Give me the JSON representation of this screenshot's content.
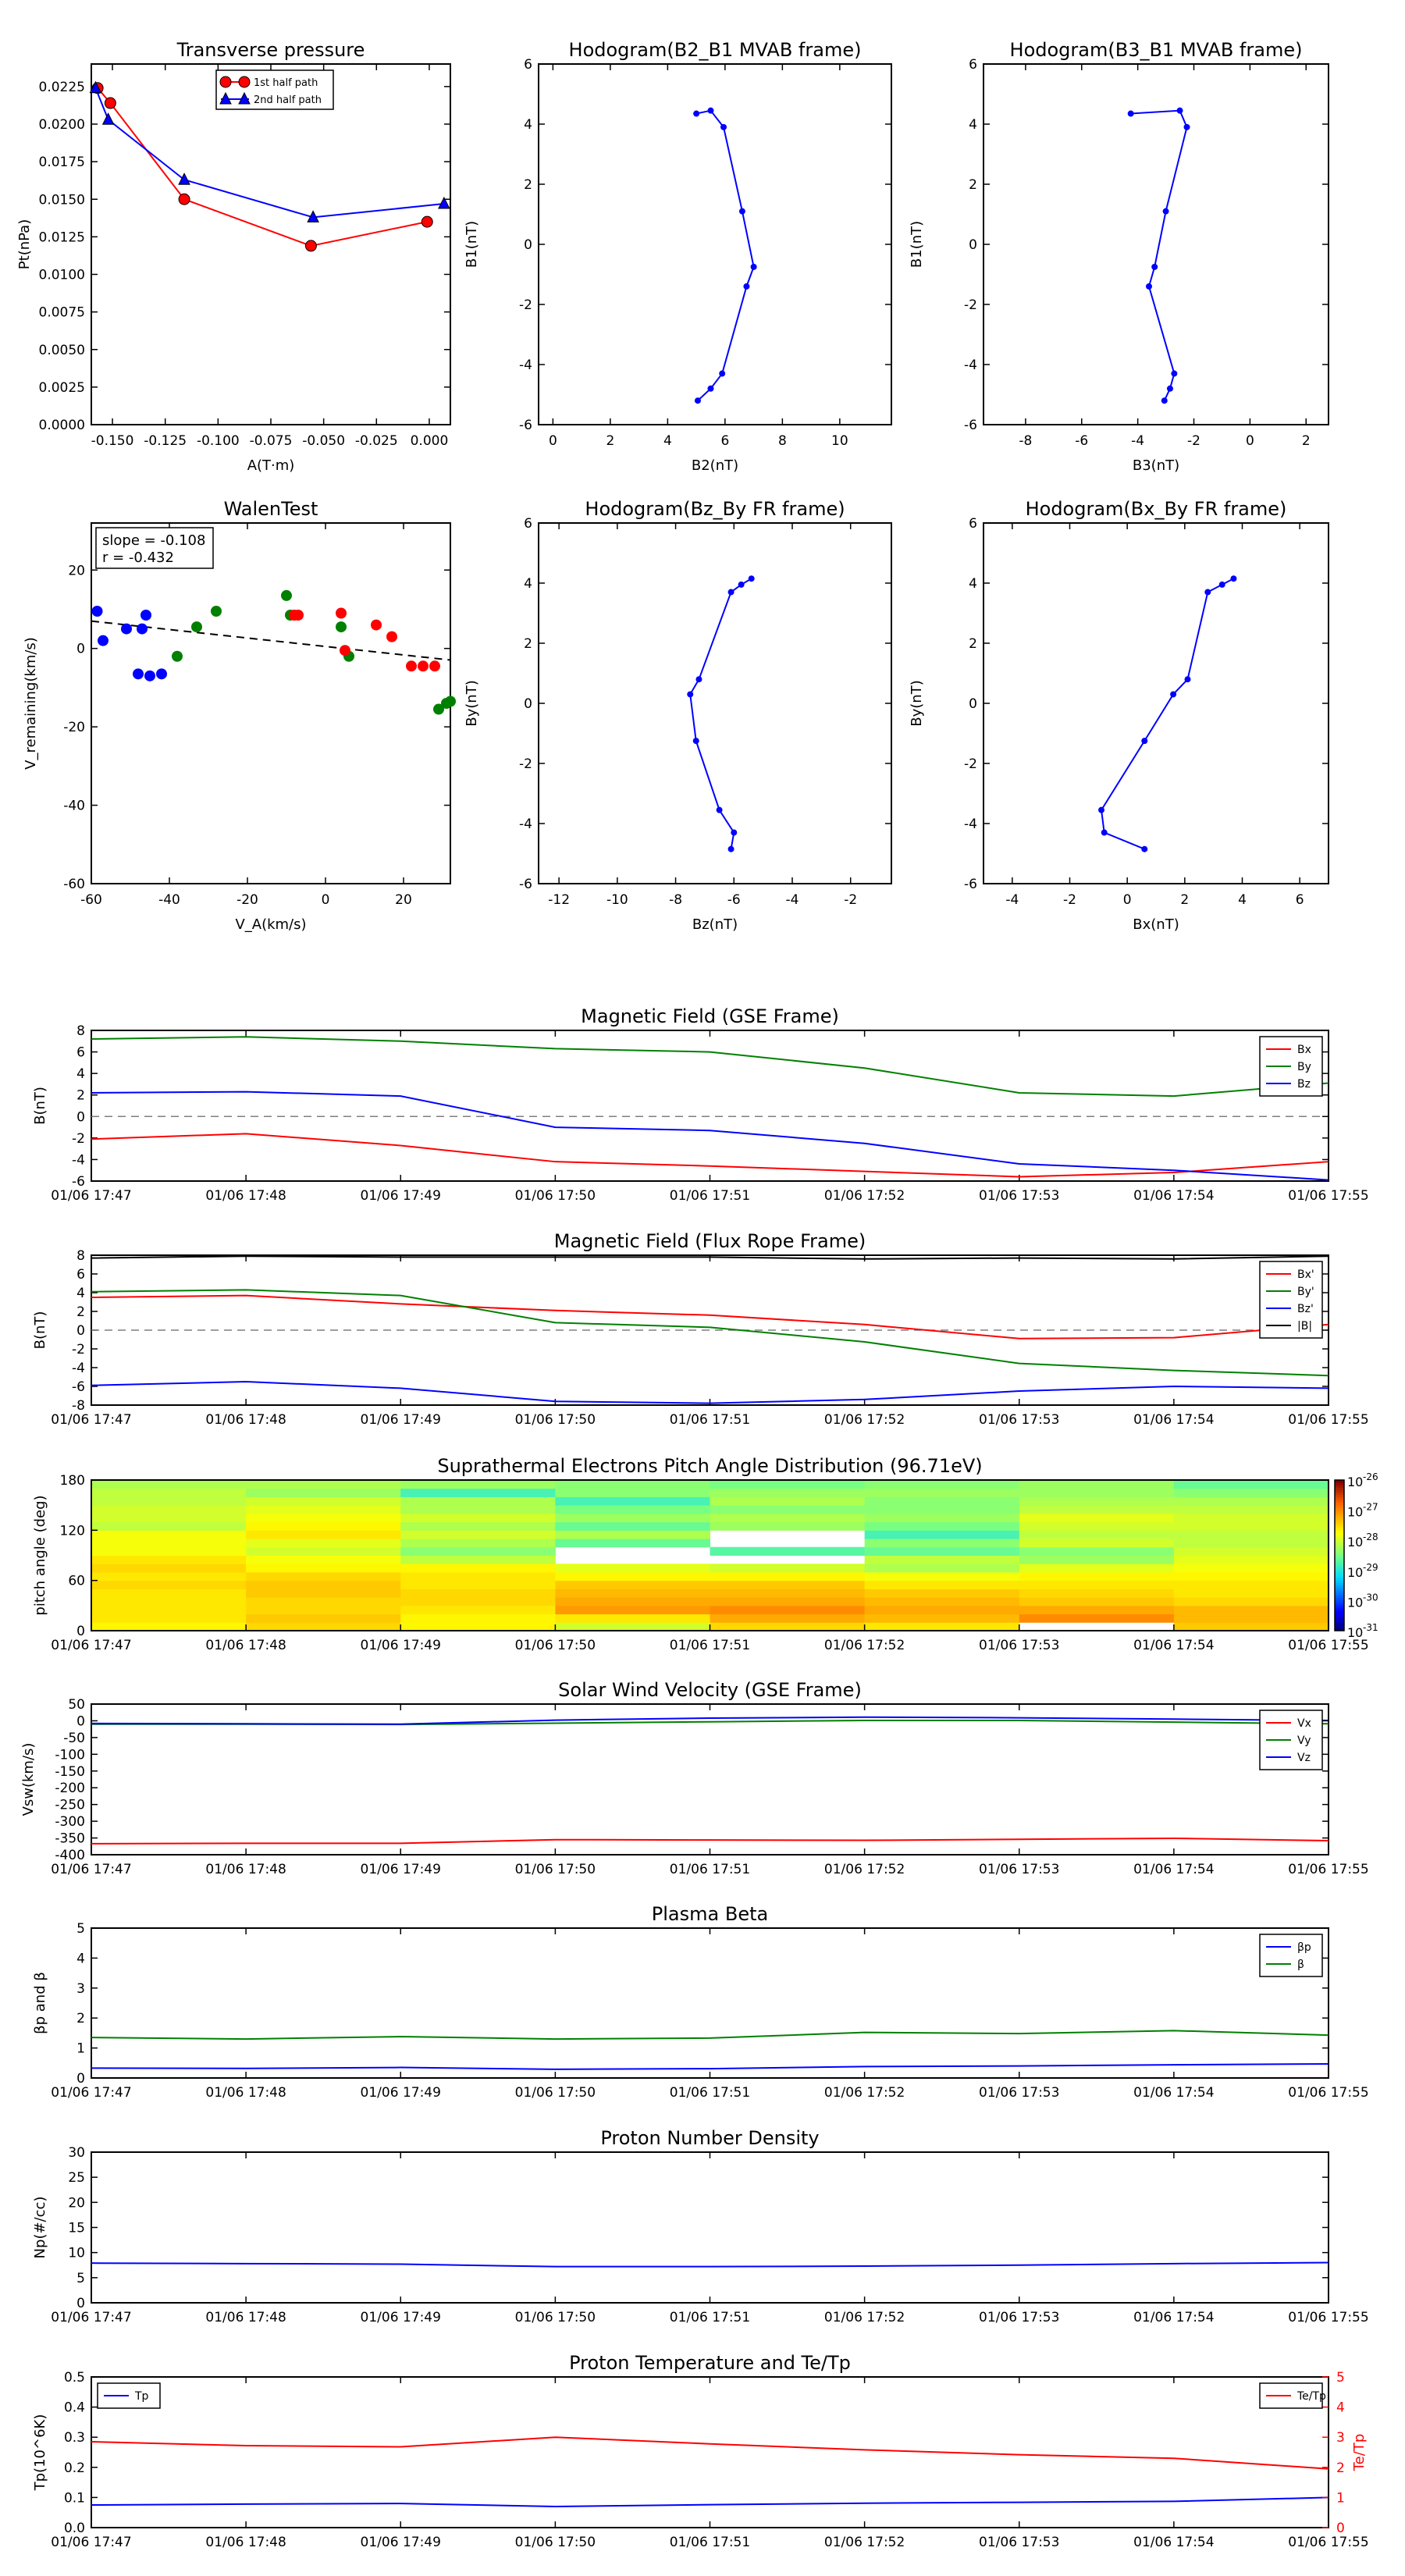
{
  "times": [
    "01/06 17:47",
    "01/06 17:48",
    "01/06 17:49",
    "01/06 17:50",
    "01/06 17:51",
    "01/06 17:52",
    "01/06 17:53",
    "01/06 17:54",
    "01/06 17:55"
  ],
  "colors": {
    "red": "#ff0000",
    "green": "#008000",
    "blue": "#0000ff",
    "black": "#000000",
    "gray": "#7f7f7f"
  },
  "chart_data": [
    {
      "id": "pt",
      "type": "line",
      "title": "Transverse pressure",
      "xlabel": "A(T·m)",
      "ylabel": "Pt(nPa)",
      "xlim": [
        -0.16,
        0.01
      ],
      "ylim": [
        0,
        0.024
      ],
      "xticks": [
        "-0.150",
        "-0.125",
        "-0.100",
        "-0.075",
        "-0.050",
        "-0.025",
        "0.000"
      ],
      "yticks": [
        "0.0000",
        "0.0025",
        "0.0050",
        "0.0075",
        "0.0100",
        "0.0125",
        "0.0150",
        "0.0175",
        "0.0200",
        "0.0225"
      ],
      "legend": "top-center",
      "series": [
        {
          "name": "1st half path",
          "color": "red",
          "marker": "circle",
          "x": [
            -0.157,
            -0.151,
            -0.116,
            -0.056,
            -0.001
          ],
          "y": [
            0.0224,
            0.0214,
            0.015,
            0.0119,
            0.0135
          ]
        },
        {
          "name": "2nd half path",
          "color": "blue",
          "marker": "triangle",
          "x": [
            -0.158,
            -0.152,
            -0.116,
            -0.055,
            0.007
          ],
          "y": [
            0.0224,
            0.0203,
            0.0163,
            0.0138,
            0.0147
          ]
        }
      ]
    },
    {
      "id": "h1",
      "type": "line",
      "title": "Hodogram(B2_B1 MVAB frame)",
      "xlabel": "B2(nT)",
      "ylabel": "B1(nT)",
      "xlim": [
        -0.5,
        11.8
      ],
      "ylim": [
        -6,
        6
      ],
      "xticks": [
        "0",
        "2",
        "4",
        "6",
        "8",
        "10"
      ],
      "yticks": [
        "-6",
        "-4",
        "-2",
        "0",
        "2",
        "4",
        "6"
      ],
      "series": [
        {
          "color": "blue",
          "marker": "dot",
          "x": [
            5.0,
            5.5,
            5.95,
            6.6,
            7.0,
            6.75,
            5.9,
            5.5,
            5.05
          ],
          "y": [
            4.35,
            4.45,
            3.9,
            1.1,
            -0.75,
            -1.4,
            -4.3,
            -4.8,
            -5.2
          ]
        }
      ]
    },
    {
      "id": "h2",
      "type": "line",
      "title": "Hodogram(B3_B1 MVAB frame)",
      "xlabel": "B3(nT)",
      "ylabel": "B1(nT)",
      "xlim": [
        -9.5,
        2.8
      ],
      "ylim": [
        -6,
        6
      ],
      "xticks": [
        "-8",
        "-6",
        "-4",
        "-2",
        "0",
        "2"
      ],
      "yticks": [
        "-6",
        "-4",
        "-2",
        "0",
        "2",
        "4",
        "6"
      ],
      "series": [
        {
          "color": "blue",
          "marker": "dot",
          "x": [
            -4.25,
            -2.5,
            -2.25,
            -3.0,
            -3.4,
            -3.6,
            -2.7,
            -2.85,
            -3.05
          ],
          "y": [
            4.35,
            4.45,
            3.9,
            1.1,
            -0.75,
            -1.4,
            -4.3,
            -4.8,
            -5.2
          ]
        }
      ]
    },
    {
      "id": "walen",
      "type": "scatter",
      "title": "WalenTest",
      "xlabel": "V_A(km/s)",
      "ylabel": "V_remaining(km/s)",
      "xlim": [
        -60,
        32
      ],
      "ylim": [
        -60,
        32
      ],
      "xticks": [
        "-60",
        "-40",
        "-20",
        "0",
        "20"
      ],
      "yticks": [
        "-60",
        "-40",
        "-20",
        "0",
        "20"
      ],
      "annotation": [
        "slope = -0.108",
        "r = -0.432"
      ],
      "fit": {
        "slope": -0.108,
        "intercept": 0.5
      },
      "series": [
        {
          "color": "blue",
          "x": [
            -58.5,
            -57,
            -51,
            -47,
            -46,
            -48,
            -45,
            -42
          ],
          "y": [
            9.5,
            2,
            5,
            5,
            8.5,
            -6.5,
            -7,
            -6.5
          ]
        },
        {
          "color": "green",
          "x": [
            -38,
            -33,
            -28,
            -10,
            -9,
            4,
            6,
            29,
            31,
            32
          ],
          "y": [
            -2,
            5.5,
            9.5,
            13.5,
            8.5,
            5.5,
            -2,
            -15.5,
            -14,
            -13.5
          ]
        },
        {
          "color": "red",
          "x": [
            -8,
            -7,
            4,
            5,
            13,
            17,
            22,
            25,
            28
          ],
          "y": [
            8.5,
            8.5,
            9,
            -0.5,
            6,
            3,
            -4.5,
            -4.5,
            -4.5
          ]
        }
      ]
    },
    {
      "id": "h3",
      "type": "line",
      "title": "Hodogram(Bz_By FR frame)",
      "xlabel": "Bz(nT)",
      "ylabel": "By(nT)",
      "xlim": [
        -12.7,
        -0.6
      ],
      "ylim": [
        -6,
        6
      ],
      "xticks": [
        "-12",
        "-10",
        "-8",
        "-6",
        "-4",
        "-2"
      ],
      "yticks": [
        "-6",
        "-4",
        "-2",
        "0",
        "2",
        "4",
        "6"
      ],
      "series": [
        {
          "color": "blue",
          "marker": "dot",
          "x": [
            -5.4,
            -5.75,
            -6.1,
            -7.2,
            -7.5,
            -7.3,
            -6.5,
            -6.0,
            -6.1
          ],
          "y": [
            4.15,
            3.95,
            3.7,
            0.8,
            0.3,
            -1.25,
            -3.55,
            -4.3,
            -4.85
          ]
        }
      ]
    },
    {
      "id": "h4",
      "type": "line",
      "title": "Hodogram(Bx_By FR frame)",
      "xlabel": "Bx(nT)",
      "ylabel": "By(nT)",
      "xlim": [
        -5,
        7
      ],
      "ylim": [
        -6,
        6
      ],
      "xticks": [
        "-4",
        "-2",
        "0",
        "2",
        "4",
        "6"
      ],
      "yticks": [
        "-6",
        "-4",
        "-2",
        "0",
        "2",
        "4",
        "6"
      ],
      "series": [
        {
          "color": "blue",
          "marker": "dot",
          "x": [
            3.7,
            3.3,
            2.8,
            2.1,
            1.6,
            0.6,
            -0.9,
            -0.8,
            0.6
          ],
          "y": [
            4.15,
            3.95,
            3.7,
            0.8,
            0.3,
            -1.25,
            -3.55,
            -4.3,
            -4.85
          ]
        }
      ]
    },
    {
      "id": "bgse",
      "type": "line",
      "title": "Magnetic Field (GSE Frame)",
      "ylabel": "B(nT)",
      "ylim": [
        -6,
        8
      ],
      "yticks": [
        "-6",
        "-4",
        "-2",
        "0",
        "2",
        "4",
        "6",
        "8"
      ],
      "zero_line": true,
      "legend": "top-right",
      "series": [
        {
          "name": "Bx",
          "color": "red",
          "x": [
            0,
            1,
            2,
            3,
            4,
            5,
            6,
            7,
            8
          ],
          "values": [
            -2.1,
            -1.6,
            -2.7,
            -4.2,
            -4.6,
            -5.1,
            -5.6,
            -5.2,
            -4.2
          ]
        },
        {
          "name": "By",
          "color": "green",
          "x": [
            0,
            1,
            2,
            3,
            4,
            5,
            6,
            7,
            8
          ],
          "values": [
            7.2,
            7.4,
            7.0,
            6.3,
            6.0,
            4.5,
            2.2,
            1.9,
            3.1
          ]
        },
        {
          "name": "Bz",
          "color": "blue",
          "x": [
            0,
            1,
            2,
            3,
            4,
            5,
            6,
            7,
            8
          ],
          "values": [
            2.2,
            2.3,
            1.9,
            -1.0,
            -1.3,
            -2.5,
            -4.4,
            -5.0,
            -5.9
          ]
        }
      ]
    },
    {
      "id": "bfr",
      "type": "line",
      "title": "Magnetic Field (Flux Rope Frame)",
      "ylabel": "B(nT)",
      "ylim": [
        -8,
        8
      ],
      "yticks": [
        "-8",
        "-6",
        "-4",
        "-2",
        "0",
        "2",
        "4",
        "6",
        "8"
      ],
      "zero_line": true,
      "legend": "top-right",
      "series": [
        {
          "name": "Bx'",
          "color": "red",
          "x": [
            0,
            1,
            2,
            3,
            4,
            5,
            6,
            7,
            8
          ],
          "values": [
            3.5,
            3.7,
            2.8,
            2.1,
            1.6,
            0.6,
            -0.9,
            -0.8,
            0.6
          ]
        },
        {
          "name": "By'",
          "color": "green",
          "x": [
            0,
            1,
            2,
            3,
            4,
            5,
            6,
            7,
            8
          ],
          "values": [
            4.1,
            4.3,
            3.7,
            0.8,
            0.3,
            -1.25,
            -3.55,
            -4.3,
            -4.85
          ]
        },
        {
          "name": "Bz'",
          "color": "blue",
          "x": [
            0,
            1,
            2,
            3,
            4,
            5,
            6,
            7,
            8
          ],
          "values": [
            -5.9,
            -5.5,
            -6.2,
            -7.6,
            -7.8,
            -7.4,
            -6.5,
            -6.0,
            -6.2
          ]
        },
        {
          "name": "|B|",
          "color": "black",
          "x": [
            0,
            1,
            2,
            3,
            4,
            5,
            6,
            7,
            8
          ],
          "values": [
            7.7,
            7.9,
            7.8,
            7.8,
            7.8,
            7.6,
            7.7,
            7.6,
            7.9
          ]
        }
      ]
    },
    {
      "id": "pad",
      "type": "heatmap",
      "title": "Suprathermal Electrons Pitch Angle Distribution (96.71eV)",
      "ylabel": "pitch angle (deg)",
      "ylim": [
        0,
        180
      ],
      "yticks": [
        "0",
        "60",
        "120",
        "180"
      ],
      "colorbar": {
        "min_exp": -31,
        "max_exp": -26,
        "ticks": [
          "-26",
          "-27",
          "-28",
          "-29",
          "-30",
          "-31"
        ]
      },
      "level_range": [
        -31,
        -26
      ],
      "columns": 8,
      "rows": 18,
      "values": [
        [
          -27.7,
          -27.6,
          -27.6,
          -27.6,
          -27.6,
          -27.5,
          -27.6,
          -27.5,
          -27.6,
          -27.8,
          -27.8,
          -27.8,
          -28.1,
          -28.0,
          -28.0,
          -28.1,
          -28.1,
          -28.2
        ],
        [
          -27.5,
          -27.4,
          -27.5,
          -27.5,
          -27.4,
          -27.4,
          -27.5,
          -27.7,
          -27.8,
          -28.0,
          -27.9,
          -27.6,
          -27.7,
          -27.8,
          -27.9,
          -28.0,
          -28.3,
          -28.2
        ],
        [
          -27.7,
          -27.7,
          -27.6,
          -27.5,
          -27.5,
          -27.6,
          -27.6,
          -27.7,
          -28.1,
          -28.4,
          -28.2,
          -28.0,
          -28.2,
          -28.0,
          -28.2,
          -28.2,
          -28.8,
          -28.3
        ],
        [
          -28.0,
          -27.6,
          -27.1,
          -27.2,
          -27.3,
          -27.4,
          -27.7,
          -27.9,
          null,
          null,
          -28.6,
          -28.2,
          -28.6,
          -28.3,
          -28.5,
          -28.8,
          -28.4,
          -28.4
        ],
        [
          -27.5,
          -27.2,
          -27.0,
          -27.2,
          -27.3,
          -27.4,
          -27.7,
          -28.0,
          null,
          -28.7,
          null,
          null,
          -28.3,
          -28.2,
          -28.4,
          -28.2,
          -28.3,
          -28.5
        ],
        [
          -27.6,
          -27.3,
          -27.2,
          -27.3,
          -27.4,
          -27.6,
          -27.8,
          -28.2,
          -28.1,
          -28.6,
          -28.4,
          -28.8,
          -28.5,
          -28.3,
          -28.4,
          -28.4,
          -28.3,
          -28.4
        ],
        [
          null,
          -27.0,
          -27.2,
          -27.4,
          -27.5,
          -27.6,
          -27.7,
          -27.9,
          -28.3,
          -28.4,
          -28.0,
          -28.1,
          -28.0,
          -27.9,
          -28.1,
          -28.2,
          -28.3,
          -28.3
        ],
        [
          -27.4,
          -27.3,
          -27.3,
          -27.5,
          -27.6,
          -27.6,
          -27.7,
          -27.8,
          -27.9,
          -28.0,
          -28.1,
          -28.1,
          -28.0,
          -28.0,
          -28.1,
          -28.2,
          -28.4,
          -28.6
        ]
      ]
    },
    {
      "id": "vsw",
      "type": "line",
      "title": "Solar Wind Velocity (GSE Frame)",
      "ylabel": "Vsw(km/s)",
      "ylim": [
        -400,
        50
      ],
      "yticks": [
        "-400",
        "-350",
        "-300",
        "-250",
        "-200",
        "-150",
        "-100",
        "-50",
        "0",
        "50"
      ],
      "legend": "top-right",
      "series": [
        {
          "name": "Vx",
          "color": "red",
          "x": [
            0,
            1,
            2,
            3,
            4,
            5,
            6,
            7,
            8
          ],
          "values": [
            -367,
            -366,
            -366,
            -355,
            -356,
            -357,
            -354,
            -351,
            -358
          ]
        },
        {
          "name": "Vy",
          "color": "green",
          "x": [
            0,
            1,
            2,
            3,
            4,
            5,
            6,
            7,
            8
          ],
          "values": [
            -10,
            -10,
            -11,
            -7,
            -3,
            1,
            1,
            -4,
            -9
          ]
        },
        {
          "name": "Vz",
          "color": "blue",
          "x": [
            0,
            1,
            2,
            3,
            4,
            5,
            6,
            7,
            8
          ],
          "values": [
            -8,
            -9,
            -10,
            2,
            8,
            11,
            9,
            5,
            1
          ]
        }
      ]
    },
    {
      "id": "beta",
      "type": "line",
      "title": "Plasma Beta",
      "ylabel": "βp and β",
      "ylim": [
        0,
        5
      ],
      "yticks": [
        "0",
        "1",
        "2",
        "3",
        "4",
        "5"
      ],
      "legend": "top-right",
      "series": [
        {
          "name": "βp",
          "color": "blue",
          "x": [
            0,
            1,
            2,
            3,
            4,
            5,
            6,
            7,
            8
          ],
          "values": [
            0.33,
            0.32,
            0.35,
            0.29,
            0.31,
            0.38,
            0.4,
            0.44,
            0.47
          ]
        },
        {
          "name": "β",
          "color": "green",
          "x": [
            0,
            1,
            2,
            3,
            4,
            5,
            6,
            7,
            8
          ],
          "values": [
            1.35,
            1.3,
            1.38,
            1.3,
            1.33,
            1.52,
            1.48,
            1.58,
            1.43
          ]
        }
      ]
    },
    {
      "id": "np",
      "type": "line",
      "title": "Proton Number Density",
      "ylabel": "Np(#/cc)",
      "ylim": [
        0,
        30
      ],
      "yticks": [
        "0",
        "5",
        "10",
        "15",
        "20",
        "25",
        "30"
      ],
      "series": [
        {
          "color": "blue",
          "x": [
            0,
            1,
            2,
            3,
            4,
            5,
            6,
            7,
            8
          ],
          "values": [
            7.9,
            7.8,
            7.7,
            7.2,
            7.2,
            7.3,
            7.5,
            7.8,
            8.0
          ]
        }
      ]
    },
    {
      "id": "tp",
      "type": "line",
      "title": "Proton Temperature and Te/Tp",
      "ylabel": "Tp(10^6K)",
      "ylabel_right": "Te/Tp",
      "ylim": [
        0,
        0.5
      ],
      "ylim_right": [
        0,
        5
      ],
      "yticks": [
        "0.0",
        "0.1",
        "0.2",
        "0.3",
        "0.4",
        "0.5"
      ],
      "yticks_right": [
        "0",
        "1",
        "2",
        "3",
        "4",
        "5"
      ],
      "legend": [
        "top-left",
        "top-right"
      ],
      "series": [
        {
          "name": "Tp",
          "color": "blue",
          "axis": "left",
          "x": [
            0,
            1,
            2,
            3,
            4,
            5,
            6,
            7,
            8
          ],
          "values": [
            0.075,
            0.078,
            0.08,
            0.07,
            0.076,
            0.081,
            0.084,
            0.087,
            0.1
          ]
        },
        {
          "name": "Te/Tp",
          "color": "red",
          "axis": "right",
          "x": [
            0,
            1,
            2,
            3,
            4,
            5,
            6,
            7,
            8
          ],
          "values": [
            2.85,
            2.72,
            2.68,
            3.0,
            2.78,
            2.58,
            2.42,
            2.3,
            1.95
          ]
        }
      ]
    }
  ]
}
